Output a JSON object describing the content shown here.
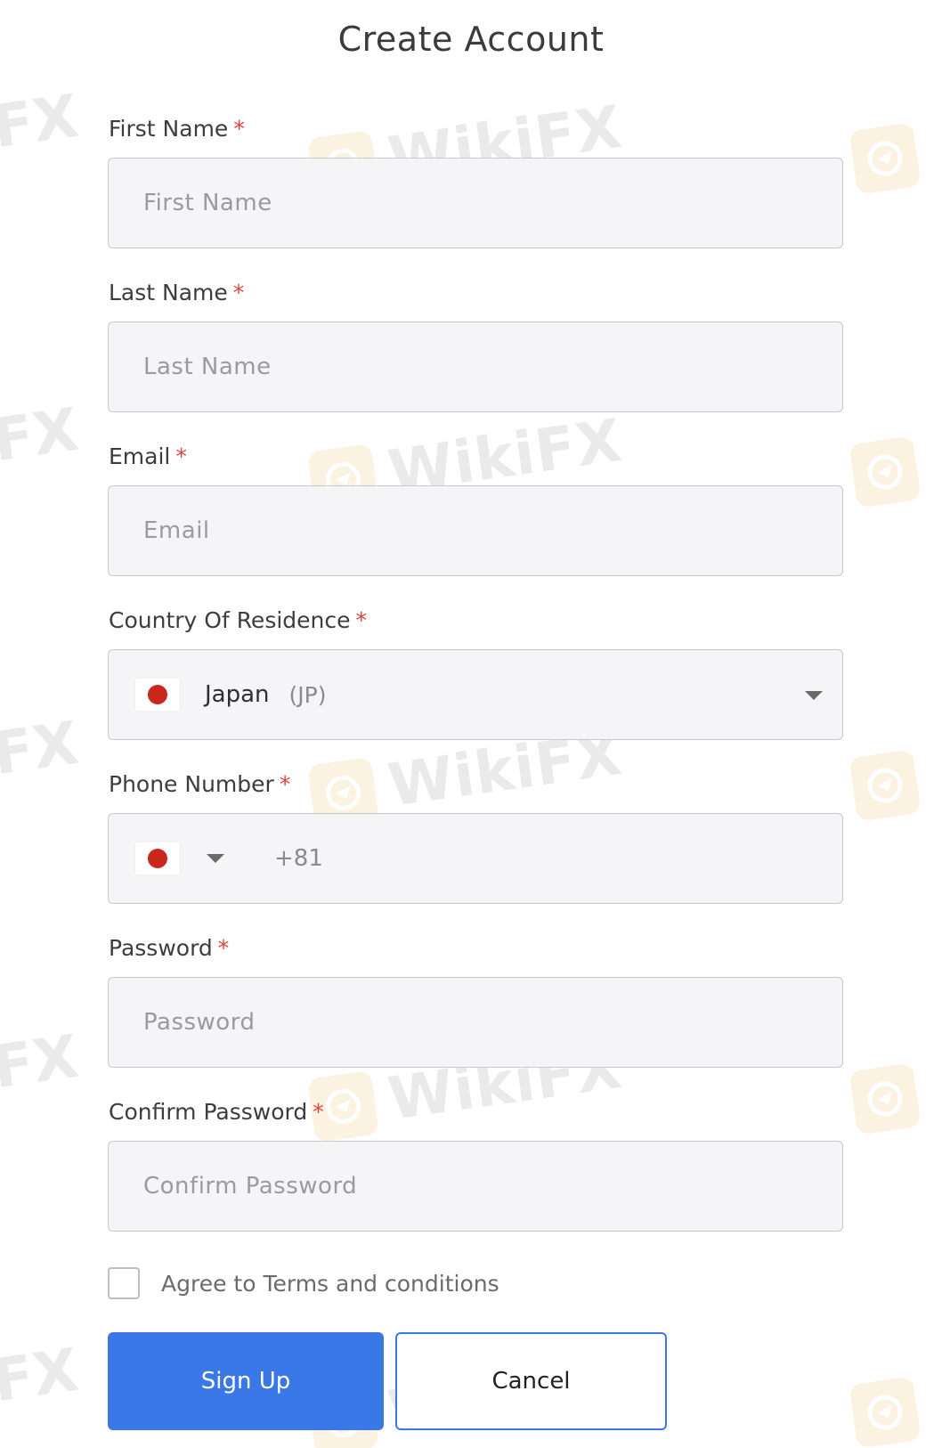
{
  "title": "Create Account",
  "required_mark": "*",
  "fields": {
    "first_name": {
      "label": "First Name",
      "placeholder": "First Name"
    },
    "last_name": {
      "label": "Last Name",
      "placeholder": "Last Name"
    },
    "email": {
      "label": "Email",
      "placeholder": "Email"
    },
    "country": {
      "label": "Country Of Residence",
      "selected": "Japan",
      "code": "(JP)"
    },
    "phone": {
      "label": "Phone Number",
      "dial_code": "+81"
    },
    "password": {
      "label": "Password",
      "placeholder": "Password"
    },
    "confirm_password": {
      "label": "Confirm Password",
      "placeholder": "Confirm Password"
    }
  },
  "terms": {
    "label": "Agree to Terms and conditions",
    "checked": false
  },
  "buttons": {
    "sign_up": "Sign Up",
    "cancel": "Cancel"
  },
  "watermark": {
    "text": "WikiFX",
    "edge_text": "FX"
  },
  "colors": {
    "primary": "#3b78e7",
    "required": "#e0433a",
    "flag_dot": "#c9271e",
    "watermark_logo": "#e8a93a"
  }
}
